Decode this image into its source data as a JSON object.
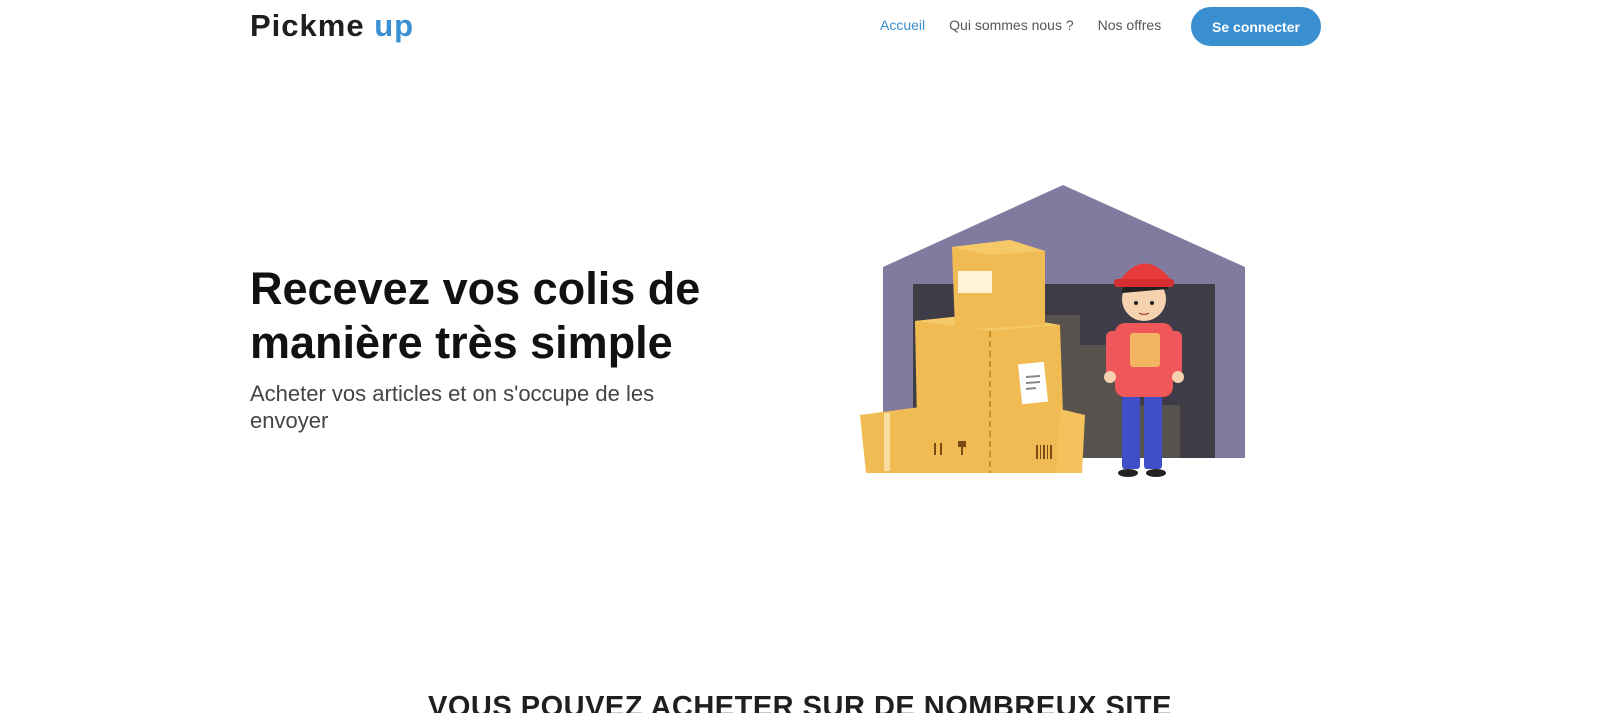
{
  "brand": {
    "name_part1": "Pickme",
    "name_part2": "up"
  },
  "nav": {
    "items": [
      {
        "label": "Accueil",
        "active": true
      },
      {
        "label": "Qui sommes nous ?",
        "active": false
      },
      {
        "label": "Nos offres",
        "active": false
      }
    ],
    "login_label": "Se connecter"
  },
  "hero": {
    "title_line1": "Recevez vos colis de",
    "title_line2": "manière très simple",
    "subtitle": "Acheter vos articles et on s'occupe de les envoyer"
  },
  "illustration": {
    "icon": "warehouse-delivery-illustration"
  },
  "section": {
    "heading": "VOUS POUVEZ ACHETER SUR DE NOMBREUX SITE"
  },
  "colors": {
    "accent": "#3a8fd0",
    "warehouse": "#827ba0",
    "box": "#f0bb52",
    "cap": "#e73b3b"
  }
}
